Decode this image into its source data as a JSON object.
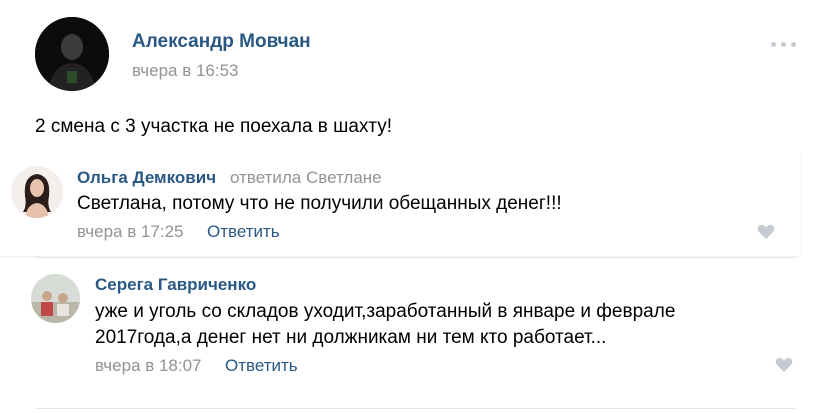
{
  "post": {
    "author": "Александр Мовчан",
    "time": "вчера в 16:53",
    "text": "2 смена с 3 участка не поехала в шахту!"
  },
  "comments": [
    {
      "author": "Ольга Демкович",
      "reply_to": "ответила Светлане",
      "text": "Светлана, потому что не получили обещанных денег!!!",
      "time": "вчера в 17:25",
      "reply_label": "Ответить"
    },
    {
      "author": "Серега Гавриченко",
      "text_line1": "уже и уголь со складов уходит,заработанный в январе и феврале",
      "text_line2": "2017года,а денег нет ни должникам ни тем кто работает...",
      "time": "вчера в 18:07",
      "reply_label": "Ответить"
    }
  ],
  "icons": {
    "more": "more-dots-icon",
    "like": "heart-icon"
  },
  "colors": {
    "link": "#2a5885",
    "meta": "#939393",
    "icon": "#c5cbd2"
  }
}
